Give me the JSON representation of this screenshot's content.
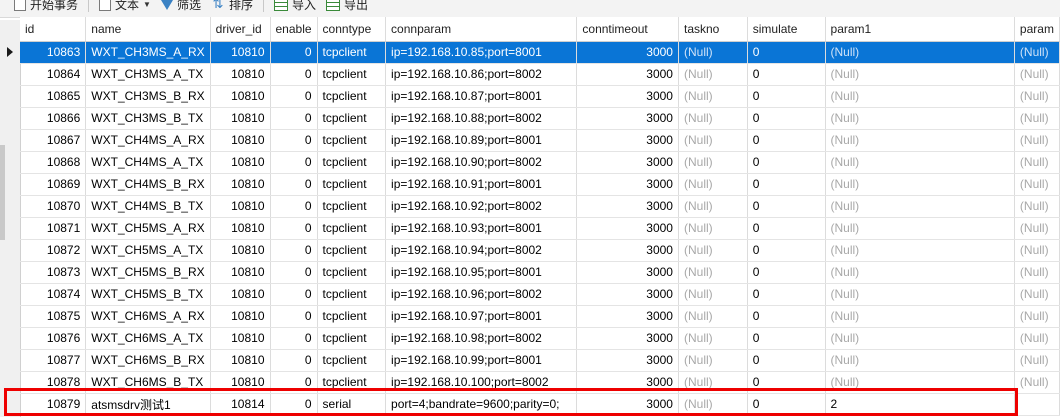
{
  "toolbar": {
    "begin_transaction": "开始事务",
    "text": "文本",
    "filter": "筛选",
    "sort": "排序",
    "import": "导入",
    "export": "导出"
  },
  "columns": [
    "id",
    "name",
    "driver_id",
    "enable",
    "conntype",
    "connparam",
    "conntimeout",
    "taskno",
    "simulate",
    "param1",
    "param"
  ],
  "rows": [
    {
      "id": "10863",
      "name": "WXT_CH3MS_A_RX",
      "driver_id": "10810",
      "enable": "0",
      "conntype": "tcpclient",
      "connparam": "ip=192.168.10.85;port=8001",
      "conntimeout": "3000",
      "taskno": "(Null)",
      "simulate": "0",
      "param1": "(Null)",
      "param": "(Null)"
    },
    {
      "id": "10864",
      "name": "WXT_CH3MS_A_TX",
      "driver_id": "10810",
      "enable": "0",
      "conntype": "tcpclient",
      "connparam": "ip=192.168.10.86;port=8002",
      "conntimeout": "3000",
      "taskno": "(Null)",
      "simulate": "0",
      "param1": "(Null)",
      "param": "(Null)"
    },
    {
      "id": "10865",
      "name": "WXT_CH3MS_B_RX",
      "driver_id": "10810",
      "enable": "0",
      "conntype": "tcpclient",
      "connparam": "ip=192.168.10.87;port=8001",
      "conntimeout": "3000",
      "taskno": "(Null)",
      "simulate": "0",
      "param1": "(Null)",
      "param": "(Null)"
    },
    {
      "id": "10866",
      "name": "WXT_CH3MS_B_TX",
      "driver_id": "10810",
      "enable": "0",
      "conntype": "tcpclient",
      "connparam": "ip=192.168.10.88;port=8002",
      "conntimeout": "3000",
      "taskno": "(Null)",
      "simulate": "0",
      "param1": "(Null)",
      "param": "(Null)"
    },
    {
      "id": "10867",
      "name": "WXT_CH4MS_A_RX",
      "driver_id": "10810",
      "enable": "0",
      "conntype": "tcpclient",
      "connparam": "ip=192.168.10.89;port=8001",
      "conntimeout": "3000",
      "taskno": "(Null)",
      "simulate": "0",
      "param1": "(Null)",
      "param": "(Null)"
    },
    {
      "id": "10868",
      "name": "WXT_CH4MS_A_TX",
      "driver_id": "10810",
      "enable": "0",
      "conntype": "tcpclient",
      "connparam": "ip=192.168.10.90;port=8002",
      "conntimeout": "3000",
      "taskno": "(Null)",
      "simulate": "0",
      "param1": "(Null)",
      "param": "(Null)"
    },
    {
      "id": "10869",
      "name": "WXT_CH4MS_B_RX",
      "driver_id": "10810",
      "enable": "0",
      "conntype": "tcpclient",
      "connparam": "ip=192.168.10.91;port=8001",
      "conntimeout": "3000",
      "taskno": "(Null)",
      "simulate": "0",
      "param1": "(Null)",
      "param": "(Null)"
    },
    {
      "id": "10870",
      "name": "WXT_CH4MS_B_TX",
      "driver_id": "10810",
      "enable": "0",
      "conntype": "tcpclient",
      "connparam": "ip=192.168.10.92;port=8002",
      "conntimeout": "3000",
      "taskno": "(Null)",
      "simulate": "0",
      "param1": "(Null)",
      "param": "(Null)"
    },
    {
      "id": "10871",
      "name": "WXT_CH5MS_A_RX",
      "driver_id": "10810",
      "enable": "0",
      "conntype": "tcpclient",
      "connparam": "ip=192.168.10.93;port=8001",
      "conntimeout": "3000",
      "taskno": "(Null)",
      "simulate": "0",
      "param1": "(Null)",
      "param": "(Null)"
    },
    {
      "id": "10872",
      "name": "WXT_CH5MS_A_TX",
      "driver_id": "10810",
      "enable": "0",
      "conntype": "tcpclient",
      "connparam": "ip=192.168.10.94;port=8002",
      "conntimeout": "3000",
      "taskno": "(Null)",
      "simulate": "0",
      "param1": "(Null)",
      "param": "(Null)"
    },
    {
      "id": "10873",
      "name": "WXT_CH5MS_B_RX",
      "driver_id": "10810",
      "enable": "0",
      "conntype": "tcpclient",
      "connparam": "ip=192.168.10.95;port=8001",
      "conntimeout": "3000",
      "taskno": "(Null)",
      "simulate": "0",
      "param1": "(Null)",
      "param": "(Null)"
    },
    {
      "id": "10874",
      "name": "WXT_CH5MS_B_TX",
      "driver_id": "10810",
      "enable": "0",
      "conntype": "tcpclient",
      "connparam": "ip=192.168.10.96;port=8002",
      "conntimeout": "3000",
      "taskno": "(Null)",
      "simulate": "0",
      "param1": "(Null)",
      "param": "(Null)"
    },
    {
      "id": "10875",
      "name": "WXT_CH6MS_A_RX",
      "driver_id": "10810",
      "enable": "0",
      "conntype": "tcpclient",
      "connparam": "ip=192.168.10.97;port=8001",
      "conntimeout": "3000",
      "taskno": "(Null)",
      "simulate": "0",
      "param1": "(Null)",
      "param": "(Null)"
    },
    {
      "id": "10876",
      "name": "WXT_CH6MS_A_TX",
      "driver_id": "10810",
      "enable": "0",
      "conntype": "tcpclient",
      "connparam": "ip=192.168.10.98;port=8002",
      "conntimeout": "3000",
      "taskno": "(Null)",
      "simulate": "0",
      "param1": "(Null)",
      "param": "(Null)"
    },
    {
      "id": "10877",
      "name": "WXT_CH6MS_B_RX",
      "driver_id": "10810",
      "enable": "0",
      "conntype": "tcpclient",
      "connparam": "ip=192.168.10.99;port=8001",
      "conntimeout": "3000",
      "taskno": "(Null)",
      "simulate": "0",
      "param1": "(Null)",
      "param": "(Null)"
    },
    {
      "id": "10878",
      "name": "WXT_CH6MS_B_TX",
      "driver_id": "10810",
      "enable": "0",
      "conntype": "tcpclient",
      "connparam": "ip=192.168.10.100;port=8002",
      "conntimeout": "3000",
      "taskno": "(Null)",
      "simulate": "0",
      "param1": "(Null)",
      "param": "(Null)"
    },
    {
      "id": "10879",
      "name": "atsmsdrv测试1",
      "driver_id": "10814",
      "enable": "0",
      "conntype": "serial",
      "connparam": "port=4;bandrate=9600;parity=0;",
      "conntimeout": "3000",
      "taskno": "(Null)",
      "simulate": "0",
      "param1": "2",
      "param": ""
    }
  ],
  "selected_row_index": 0,
  "highlighted_row_index": 16,
  "colors": {
    "selection": "#0a75d6",
    "null_text": "#a8a8a8",
    "highlight_border": "#ee0000",
    "grid_line": "#dcdcdc"
  },
  "icons": {
    "begin_transaction": "document-icon",
    "text": "text-icon",
    "filter": "funnel-icon",
    "sort": "sort-icon",
    "import": "import-icon",
    "export": "export-icon",
    "row_indicator": "current-row-arrow-icon"
  }
}
